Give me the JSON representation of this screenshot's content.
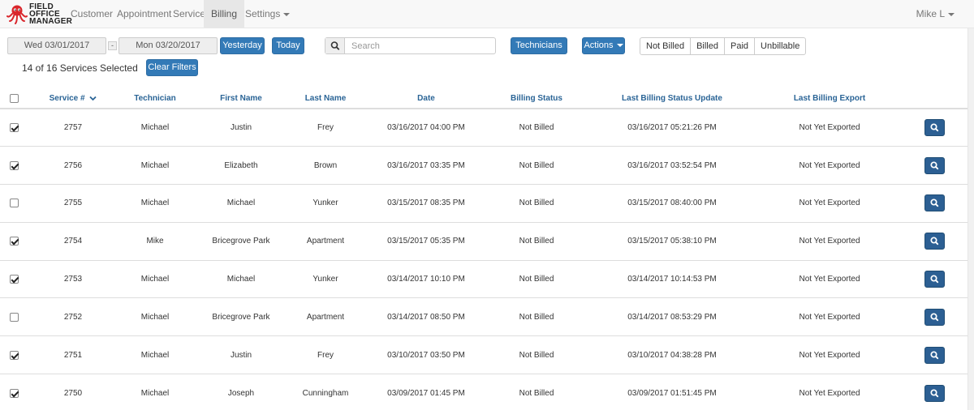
{
  "app": {
    "logo_text": [
      "FIELD",
      "OFFICE",
      "MANAGER"
    ],
    "colors": {
      "primary": "#337ab7",
      "logo": "#d9262c",
      "link": "#2a6496"
    }
  },
  "nav": {
    "items": [
      {
        "label": "Customer"
      },
      {
        "label": "Appointment"
      },
      {
        "label": "Service"
      },
      {
        "label": "Billing",
        "active": true
      },
      {
        "label": "Settings",
        "dropdown": true
      }
    ],
    "user": "Mike L"
  },
  "toolbar": {
    "start_date": "Wed 03/01/2017",
    "range_separator": "-",
    "end_date": "Mon 03/20/2017",
    "yesterday_label": "Yesterday",
    "today_label": "Today",
    "search_placeholder": "Search",
    "search_value": "",
    "technicians_label": "Technicians",
    "actions_label": "Actions",
    "billing_filters": [
      "Not Billed",
      "Billed",
      "Paid",
      "Unbillable"
    ],
    "selected_text": "14 of 16 Services Selected",
    "clear_filters_label": "Clear Filters"
  },
  "table": {
    "columns": [
      "Service #",
      "Technician",
      "First Name",
      "Last Name",
      "Date",
      "Billing Status",
      "Last Billing Status Update",
      "Last Billing Export"
    ],
    "sorted_column": "Service #",
    "sort_direction": "descending",
    "select_all_checked": false,
    "rows": [
      {
        "checked": true,
        "service": "2757",
        "technician": "Michael",
        "first": "Justin",
        "last": "Frey",
        "date": "03/16/2017 04:00 PM",
        "status": "Not Billed",
        "update": "03/16/2017 05:21:26 PM",
        "export": "Not Yet Exported"
      },
      {
        "checked": true,
        "service": "2756",
        "technician": "Michael",
        "first": "Elizabeth",
        "last": "Brown",
        "date": "03/16/2017 03:35 PM",
        "status": "Not Billed",
        "update": "03/16/2017 03:52:54 PM",
        "export": "Not Yet Exported"
      },
      {
        "checked": false,
        "service": "2755",
        "technician": "Michael",
        "first": "Michael",
        "last": "Yunker",
        "date": "03/15/2017 08:35 PM",
        "status": "Not Billed",
        "update": "03/15/2017 08:40:00 PM",
        "export": "Not Yet Exported"
      },
      {
        "checked": true,
        "service": "2754",
        "technician": "Mike",
        "first": "Bricegrove Park",
        "last": "Apartment",
        "date": "03/15/2017 05:35 PM",
        "status": "Not Billed",
        "update": "03/15/2017 05:38:10 PM",
        "export": "Not Yet Exported"
      },
      {
        "checked": true,
        "service": "2753",
        "technician": "Michael",
        "first": "Michael",
        "last": "Yunker",
        "date": "03/14/2017 10:10 PM",
        "status": "Not Billed",
        "update": "03/14/2017 10:14:53 PM",
        "export": "Not Yet Exported"
      },
      {
        "checked": false,
        "service": "2752",
        "technician": "Michael",
        "first": "Bricegrove Park",
        "last": "Apartment",
        "date": "03/14/2017 08:50 PM",
        "status": "Not Billed",
        "update": "03/14/2017 08:53:29 PM",
        "export": "Not Yet Exported"
      },
      {
        "checked": true,
        "service": "2751",
        "technician": "Michael",
        "first": "Justin",
        "last": "Frey",
        "date": "03/10/2017 03:50 PM",
        "status": "Not Billed",
        "update": "03/10/2017 04:38:28 PM",
        "export": "Not Yet Exported"
      },
      {
        "checked": true,
        "service": "2750",
        "technician": "Michael",
        "first": "Joseph",
        "last": "Cunningham",
        "date": "03/09/2017 01:45 PM",
        "status": "Not Billed",
        "update": "03/09/2017 01:51:45 PM",
        "export": "Not Yet Exported"
      }
    ],
    "row_action_icon": "search-icon"
  }
}
